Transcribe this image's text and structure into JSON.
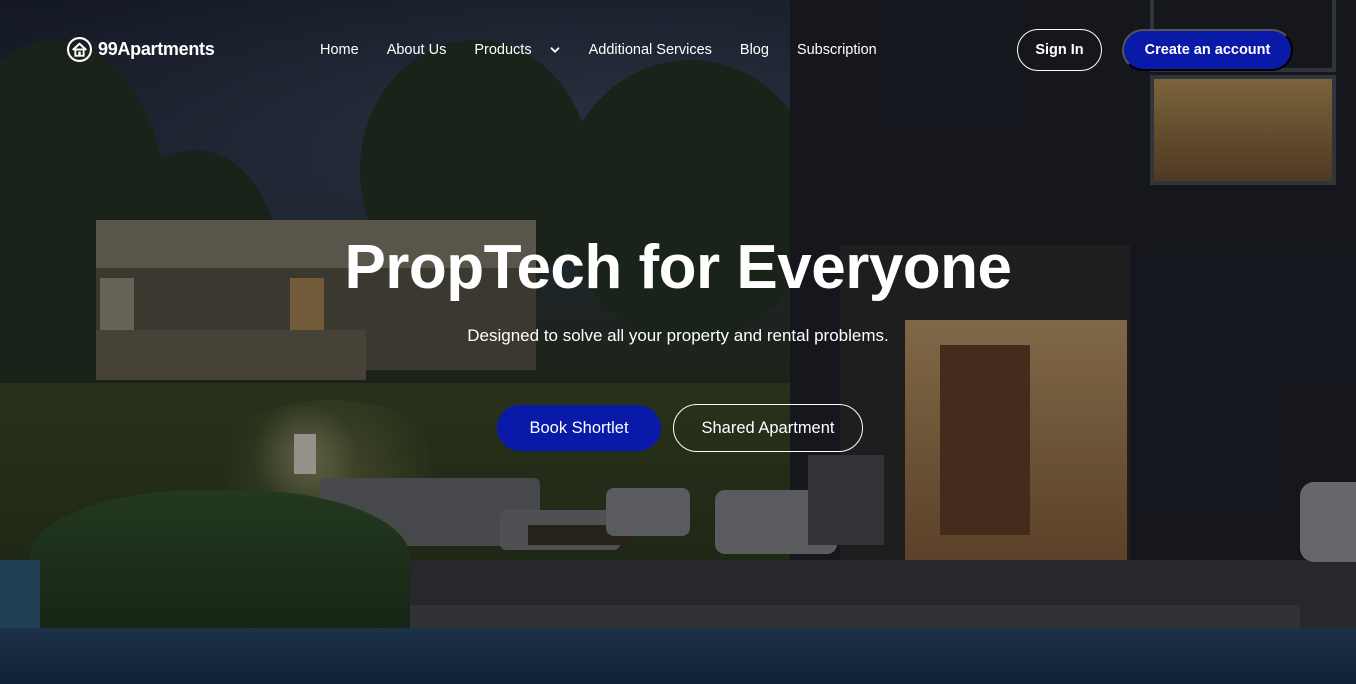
{
  "brand": {
    "name": "99Apartments",
    "icon": "house-icon"
  },
  "nav": {
    "home": "Home",
    "about": "About Us",
    "products": "Products",
    "products_icon": "chevron-down-icon",
    "services": "Additional Services",
    "blog": "Blog",
    "subscription": "Subscription"
  },
  "auth": {
    "signin": "Sign In",
    "create": "Create an account"
  },
  "hero": {
    "title": "PropTech for Everyone",
    "subtitle": "Designed to solve all your property and rental problems.",
    "primary_cta": "Book Shortlet",
    "secondary_cta": "Shared Apartment"
  },
  "colors": {
    "accent": "#0a1aa8",
    "text": "#ffffff"
  }
}
